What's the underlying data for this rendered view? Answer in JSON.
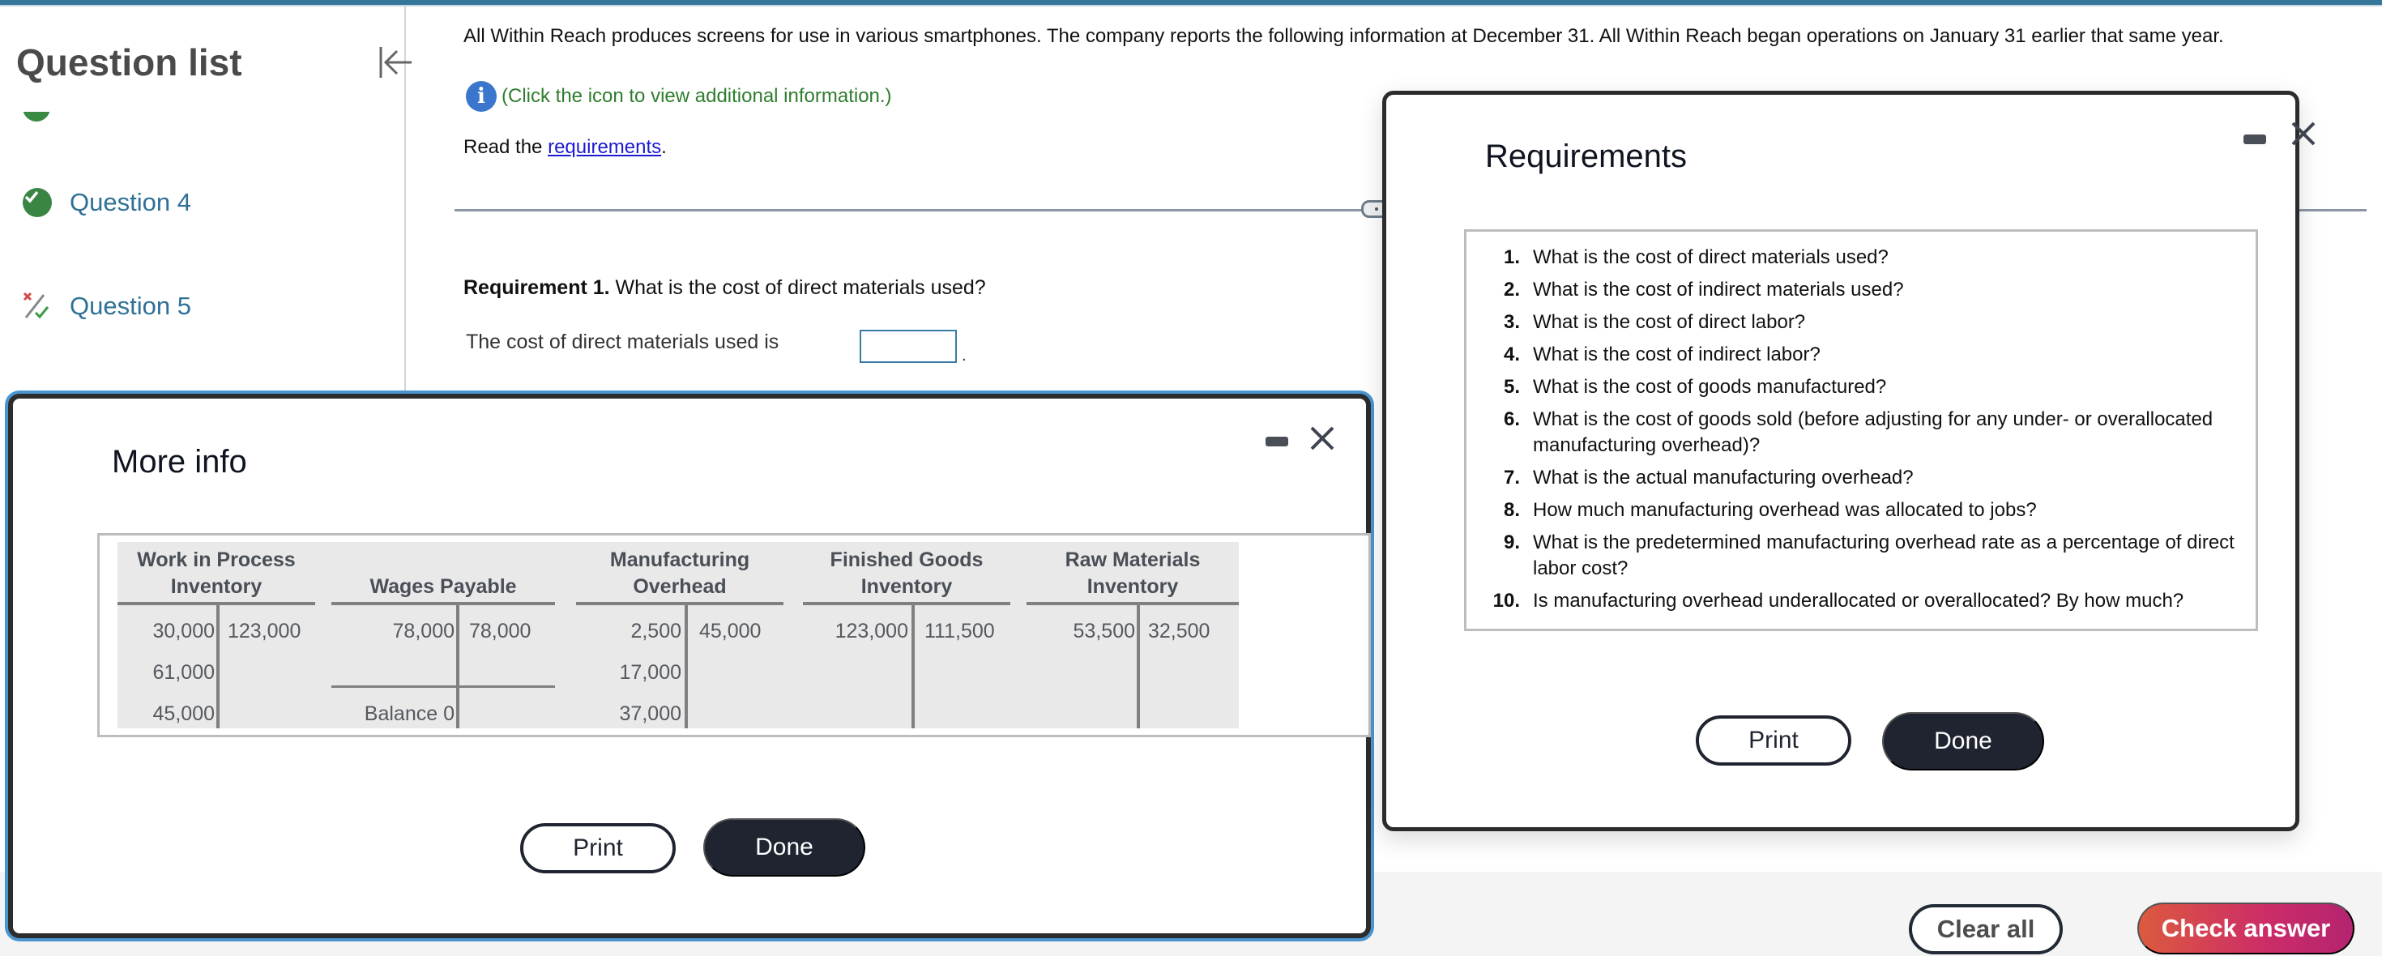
{
  "sidebar": {
    "title": "Question list",
    "collapse_icon": "collapse-left-icon",
    "items": [
      {
        "label": "Question 4",
        "status": "correct",
        "icon": "check-circle-icon"
      },
      {
        "label": "Question 5",
        "status": "partially-correct",
        "icon": "partial-correct-icon"
      }
    ]
  },
  "question": {
    "intro": "All Within Reach produces screens for use in various smartphones. The company reports the following information at December 31. All Within Reach began operations on January 31 earlier that same year.",
    "info_link": "(Click the icon to view additional information.)",
    "read_prefix": "Read the ",
    "read_link": "requirements",
    "read_suffix": ".",
    "requirement_label": "Requirement 1.",
    "requirement_text": " What is the cost of direct materials used?",
    "answer_prompt": "The cost of direct materials used is",
    "answer_value": "",
    "answer_suffix": "."
  },
  "footer": {
    "clear_all": "Clear all",
    "check_answer": "Check answer"
  },
  "more_info": {
    "title": "More info",
    "print": "Print",
    "done": "Done",
    "accounts": [
      {
        "name_line1": "Work in Process",
        "name_line2": "Inventory",
        "debits": [
          "30,000",
          "61,000",
          "45,000"
        ],
        "credits": [
          "123,000"
        ]
      },
      {
        "name_line1": "",
        "name_line2": "Wages Payable",
        "debits": [
          "78,000"
        ],
        "credits": [
          "78,000"
        ],
        "balance": "Balance 0"
      },
      {
        "name_line1": "Manufacturing",
        "name_line2": "Overhead",
        "debits": [
          "2,500",
          "17,000",
          "37,000"
        ],
        "credits": [
          "45,000"
        ]
      },
      {
        "name_line1": "Finished Goods",
        "name_line2": "Inventory",
        "debits": [
          "123,000"
        ],
        "credits": [
          "111,500"
        ]
      },
      {
        "name_line1": "Raw Materials",
        "name_line2": "Inventory",
        "debits": [
          "53,500"
        ],
        "credits": [
          "32,500"
        ]
      }
    ]
  },
  "requirements": {
    "title": "Requirements",
    "print": "Print",
    "done": "Done",
    "items": [
      {
        "num": "1.",
        "text": "What is the cost of direct materials used?"
      },
      {
        "num": "2.",
        "text": "What is the cost of indirect materials used?"
      },
      {
        "num": "3.",
        "text": "What is the cost of direct labor?"
      },
      {
        "num": "4.",
        "text": "What is the cost of indirect labor?"
      },
      {
        "num": "5.",
        "text": "What is the cost of goods manufactured?"
      },
      {
        "num": "6.",
        "text": "What is the cost of goods sold (before adjusting for any under- or overallocated manufacturing overhead)?"
      },
      {
        "num": "7.",
        "text": "What is the actual manufacturing overhead?"
      },
      {
        "num": "8.",
        "text": "How much manufacturing overhead was allocated to jobs?"
      },
      {
        "num": "9.",
        "text": "What is the predetermined manufacturing overhead rate as a percentage of direct labor cost?"
      },
      {
        "num": "10.",
        "text": "Is manufacturing overhead underallocated or overallocated? By how much?"
      }
    ]
  },
  "colors": {
    "accent": "#34779a",
    "link": "#2f7196",
    "correct": "#3a8444",
    "info_text": "#2e7d2e",
    "dark_button": "#1f2430",
    "check_answer_gradient_start": "#dc5a3e",
    "check_answer_gradient_end": "#b42470"
  }
}
